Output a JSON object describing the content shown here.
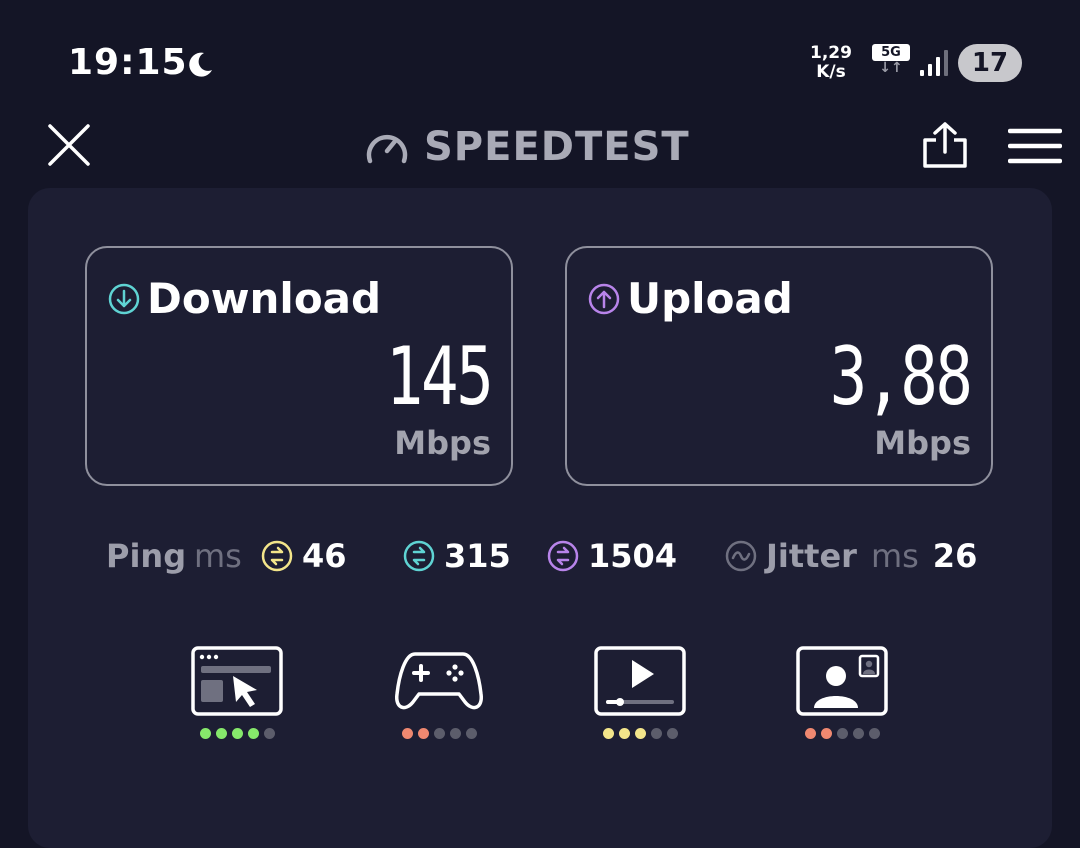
{
  "status_bar": {
    "time": "19:15",
    "net_speed_value": "1,29",
    "net_speed_unit": "K/s",
    "network": "5G",
    "battery": "17"
  },
  "header": {
    "title": "SPEEDTEST"
  },
  "download": {
    "label": "Download",
    "value": "145",
    "unit": "Mbps",
    "color": "#5fd3d3"
  },
  "upload": {
    "label": "Upload",
    "value": "3,88",
    "unit": "Mbps",
    "color": "#b884ea"
  },
  "ping": {
    "label": "Ping",
    "unit": "ms",
    "idle": {
      "value": "46",
      "color": "#f3e58a"
    },
    "download": {
      "value": "315",
      "color": "#5fd3d3"
    },
    "upload": {
      "value": "1504",
      "color": "#b884ea"
    }
  },
  "jitter": {
    "label": "Jitter",
    "unit": "ms",
    "value": "26"
  },
  "usage_ratings": [
    {
      "icon": "web-browsing-icon",
      "rating": 4,
      "max": 5,
      "color": "#86e86b"
    },
    {
      "icon": "gaming-icon",
      "rating": 2,
      "max": 5,
      "color": "#ef8870"
    },
    {
      "icon": "video-streaming-icon",
      "rating": 3,
      "max": 5,
      "color": "#f3e58a"
    },
    {
      "icon": "video-chat-icon",
      "rating": 2,
      "max": 5,
      "color": "#ef8870"
    }
  ]
}
